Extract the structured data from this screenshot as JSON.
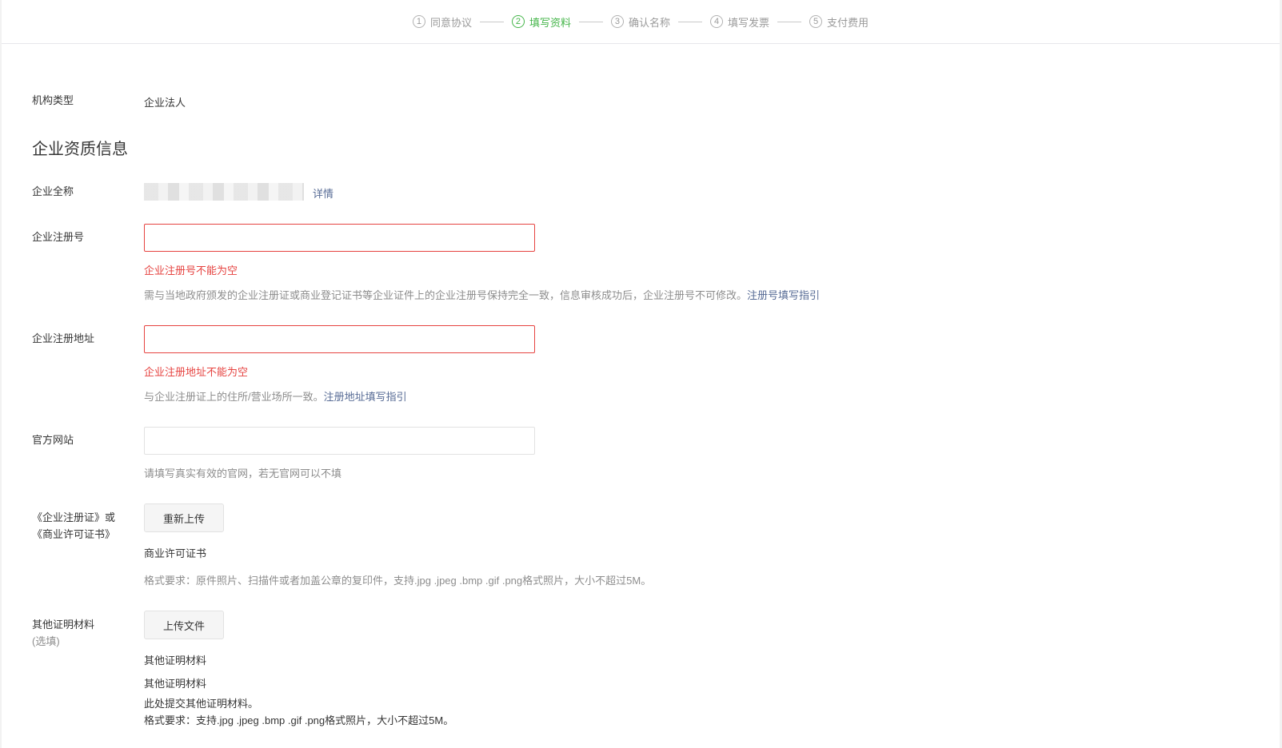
{
  "steps": [
    {
      "num": "1",
      "label": "同意协议"
    },
    {
      "num": "2",
      "label": "填写资料"
    },
    {
      "num": "3",
      "label": "确认名称"
    },
    {
      "num": "4",
      "label": "填写发票"
    },
    {
      "num": "5",
      "label": "支付费用"
    }
  ],
  "active_step": 2,
  "org_type": {
    "label": "机构类型",
    "value": "企业法人"
  },
  "section_title": "企业资质信息",
  "company_name": {
    "label": "企业全称",
    "detail_link": "详情"
  },
  "reg_no": {
    "label": "企业注册号",
    "value": "",
    "error": "企业注册号不能为空",
    "tip": "需与当地政府颁发的企业注册证或商业登记证书等企业证件上的企业注册号保持完全一致，信息审核成功后，企业注册号不可修改。",
    "guide_link": "注册号填写指引"
  },
  "reg_address": {
    "label": "企业注册地址",
    "value": "",
    "error": "企业注册地址不能为空",
    "tip": "与企业注册证上的住所/营业场所一致。",
    "guide_link": "注册地址填写指引"
  },
  "website": {
    "label": "官方网站",
    "value": "",
    "tip": "请填写真实有效的官网，若无官网可以不填"
  },
  "license": {
    "label_line1": "《企业注册证》或",
    "label_line2": "《商业许可证书》",
    "button": "重新上传",
    "file_name": "商业许可证书",
    "format_tip": "格式要求：原件照片、扫描件或者加盖公章的复印件，支持.jpg .jpeg .bmp .gif .png格式照片，大小不超过5M。"
  },
  "other": {
    "label_line1": "其他证明材料",
    "label_line2": "(选填)",
    "button": "上传文件",
    "file_name": "其他证明材料",
    "desc_title": "其他证明材料",
    "desc_line1": "此处提交其他证明材料。",
    "desc_line2": "格式要求：支持.jpg .jpeg .bmp .gif .png格式照片，大小不超过5M。"
  },
  "colors": {
    "accent_green": "#44b549",
    "error_red": "#e64340",
    "link_blue": "#576b95"
  }
}
